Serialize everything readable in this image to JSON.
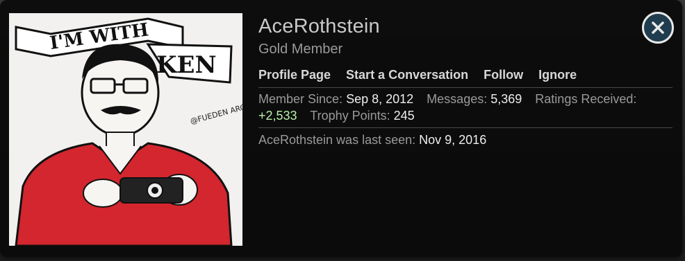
{
  "profile": {
    "username": "AceRothstein",
    "user_title": "Gold Member",
    "avatar_icon": "avatar-illustration-icon",
    "avatar_text_banner_top": "I'M WITH",
    "avatar_text_banner_bottom": "KEN",
    "avatar_text_watermark": "@FUEDEN ARCHIVE"
  },
  "links": {
    "profile_page": "Profile Page",
    "start_conversation": "Start a Conversation",
    "follow": "Follow",
    "ignore": "Ignore"
  },
  "stats": {
    "member_since_label": "Member Since:",
    "member_since_value": "Sep 8, 2012",
    "messages_label": "Messages:",
    "messages_value": "5,369",
    "ratings_label": "Ratings Received:",
    "ratings_value": "+2,533",
    "trophy_label": "Trophy Points:",
    "trophy_value": "245"
  },
  "last_seen": {
    "label": "AceRothstein was last seen:",
    "value": "Nov 9, 2016"
  },
  "close_icon": "close-icon",
  "colors": {
    "positive": "#b8f0a8",
    "close_bg": "#1f3d4e",
    "avatar_red": "#d3262e"
  }
}
